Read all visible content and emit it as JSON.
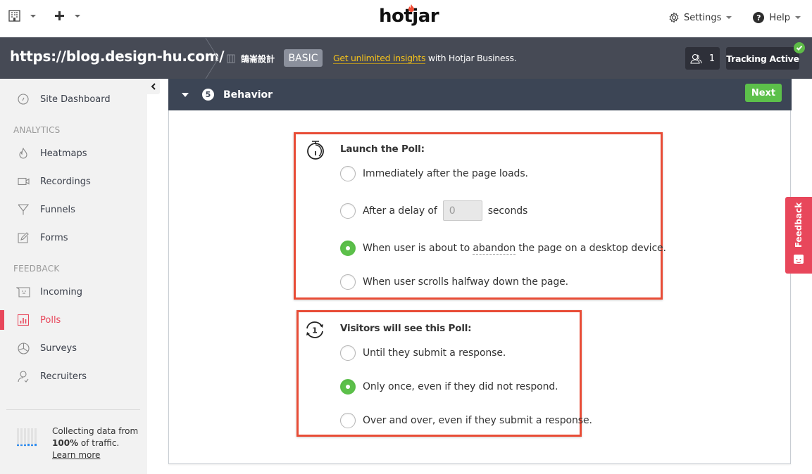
{
  "topbar": {
    "logo": "hotjar",
    "settings_label": "Settings",
    "help_label": "Help",
    "help_glyph": "?"
  },
  "sitebar": {
    "site_url": "https://blog.design-hu.com/",
    "org_name": "鵠崙設計",
    "plan_badge": "BASIC",
    "upsell_link": "Get unlimited insights",
    "upsell_rest": " with Hotjar Business.",
    "users_count": "1",
    "tracking_label": "Tracking Active"
  },
  "sidebar": {
    "dashboard": "Site Dashboard",
    "analytics_heading": "ANALYTICS",
    "analytics_items": [
      "Heatmaps",
      "Recordings",
      "Funnels",
      "Forms"
    ],
    "feedback_heading": "FEEDBACK",
    "feedback_items": [
      "Incoming",
      "Polls",
      "Surveys",
      "Recruiters"
    ],
    "active_item": "Polls",
    "traffic_line1": "Collecting data from",
    "traffic_percent": "100%",
    "traffic_line2": " of traffic.",
    "learn_more": "Learn more"
  },
  "panel": {
    "step_number": "5",
    "title": "Behavior",
    "next_label": "Next",
    "launch": {
      "title": "Launch the Poll:",
      "options": [
        "Immediately after the page loads.",
        "After a delay of",
        "When user is about to ",
        "When user scrolls halfway down the page."
      ],
      "delay_value": "0",
      "delay_unit": "seconds",
      "abandon_word": "abandon",
      "abandon_rest": " the page on a desktop device.",
      "selected_index": 2
    },
    "visibility": {
      "title": "Visitors will see this Poll:",
      "icon_number": "1",
      "options": [
        "Until they submit a response.",
        "Only once, even if they did not respond.",
        "Over and over, even if they submit a response."
      ],
      "selected_index": 1
    }
  },
  "feedback_tab": {
    "label": "Feedback"
  },
  "colors": {
    "accent_red": "#e8475b",
    "success_green": "#5cc04a",
    "highlight_box": "#e84c36",
    "header_dark": "#464a55",
    "upsell_yellow": "#f5c21b"
  }
}
